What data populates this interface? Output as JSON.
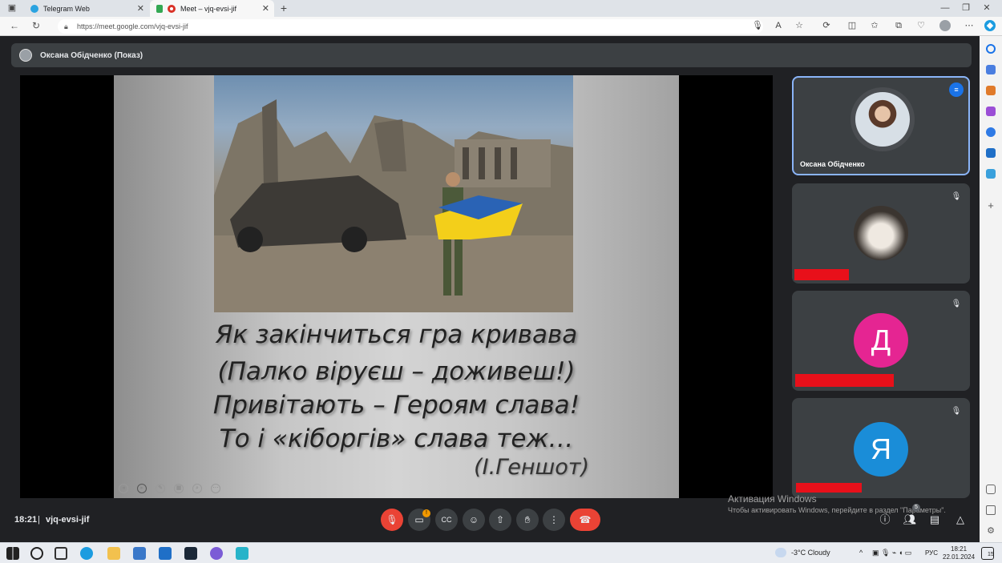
{
  "browser": {
    "tabs": [
      {
        "title": "Telegram Web"
      },
      {
        "title": "Meet – vjq-evsi-jif"
      }
    ],
    "url": "https://meet.google.com/vjq-evsi-jif"
  },
  "meet": {
    "presenter_label": "Оксана Обідченко (Показ)",
    "slide": {
      "lines": [
        "Як закінчиться гра кривава",
        "(Палко віруєш – доживеш!)",
        "Привітають – Героям слава!",
        "То і «кіборгів» слава теж…"
      ],
      "author": "(І.Геншот)"
    },
    "participants": [
      {
        "name": "Оксана Обідченко",
        "speaking": true,
        "muted": false
      },
      {
        "name": "",
        "muted": true
      },
      {
        "name": "",
        "initial": "Д",
        "avatar_color": "#e52592",
        "muted": true
      },
      {
        "name": "",
        "initial": "Я",
        "avatar_color": "#1a8dd8",
        "muted": true
      }
    ],
    "time": "18:21",
    "separator": "|",
    "meeting_code": "vjq-evsi-jif",
    "camera_badge": "!",
    "people_count": "5"
  },
  "windows": {
    "activation_title": "Активация Windows",
    "activation_text": "Чтобы активировать Windows, перейдите в раздел \"Параметры\".",
    "weather": "-3°C  Cloudy",
    "language": "РУС",
    "clock_time": "18:21",
    "clock_date": "22.01.2024",
    "notification_count": "15"
  }
}
